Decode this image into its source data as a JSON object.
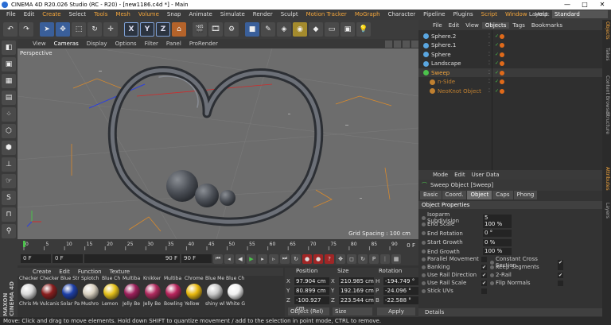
{
  "window": {
    "title": "CINEMA 4D R20.026 Studio (RC - R20) - [new1186.c4d *] - Main",
    "controls": [
      "—",
      "□",
      "✕"
    ]
  },
  "menu": {
    "items": [
      "File",
      "Edit",
      "Create",
      "Select",
      "Tools",
      "Mesh",
      "Volume",
      "Snap",
      "Animate",
      "Simulate",
      "Render",
      "Sculpt",
      "Motion Tracker",
      "MoGraph",
      "Character",
      "Pipeline",
      "Plugins",
      "Script",
      "Window",
      "Help"
    ],
    "highlight": [
      "Create",
      "Tools",
      "Mesh",
      "Volume",
      "Motion Tracker",
      "MoGraph",
      "Script",
      "Window"
    ],
    "layout_label": "Layout:",
    "layout_value": "Standard"
  },
  "toolbar": {
    "axis_labels": [
      "X",
      "Y",
      "Z"
    ]
  },
  "viewport": {
    "menu": [
      "View",
      "Cameras",
      "Display",
      "Options",
      "Filter",
      "Panel",
      "ProRender"
    ],
    "label": "Perspective",
    "grid_spacing": "Grid Spacing : 100 cm"
  },
  "timeline": {
    "ticks": [
      "0",
      "5",
      "10",
      "15",
      "20",
      "25",
      "30",
      "35",
      "40",
      "45",
      "50",
      "55",
      "60",
      "65",
      "70",
      "75",
      "80",
      "85",
      "90"
    ],
    "end_label": "0 F"
  },
  "anim": {
    "current": "0 F",
    "start": "0 F",
    "end_a": "90 F",
    "end_b": "90 F"
  },
  "materials": {
    "menu": [
      "Create",
      "Edit",
      "Function",
      "Texture"
    ],
    "items": [
      {
        "top": "Checker",
        "bottom": "Chris Me",
        "color": "#d8d8d8"
      },
      {
        "top": "Checker",
        "bottom": "Vulcanis",
        "color": "#8a1e1e"
      },
      {
        "top": "Blue Str",
        "bottom": "Solar Pa",
        "color": "#1d3fa8"
      },
      {
        "top": "Splotch",
        "bottom": "Mushro",
        "color": "#d8d0c0"
      },
      {
        "top": "Blue Ch",
        "bottom": "Lemon",
        "color": "#e5c11a"
      },
      {
        "top": "Multiba",
        "bottom": "Jelly Be",
        "color": "#9c1f5a"
      },
      {
        "top": "Knikker",
        "bottom": "Jelly Be",
        "color": "#b02a5e"
      },
      {
        "top": "Multiba",
        "bottom": "Bowling",
        "color": "#b8245c"
      },
      {
        "top": "Chrome",
        "bottom": "Yellow",
        "color": "#e8b80e"
      },
      {
        "top": "Blue Me",
        "bottom": "shiny wl",
        "color": "#c8c8c8"
      },
      {
        "top": "Blue Ch",
        "bottom": "White G",
        "color": "#f0f0f0"
      }
    ]
  },
  "coords": {
    "headers": [
      "Position",
      "Size",
      "Rotation"
    ],
    "rows": [
      {
        "a": "X",
        "pos": "97.904 cm",
        "size": "210.985 cm",
        "r": "H",
        "rot": "-194.749 °"
      },
      {
        "a": "Y",
        "pos": "80.899 cm",
        "size": "192.169 cm",
        "r": "P",
        "rot": "-24.096 °"
      },
      {
        "a": "Z",
        "pos": "-100.927 cm",
        "size": "223.544 cm",
        "r": "B",
        "rot": "-22.588 °"
      }
    ],
    "mode": "Object (Rel)",
    "size_mode": "Size",
    "apply": "Apply"
  },
  "objects": {
    "menu": [
      "File",
      "Edit",
      "View",
      "Objects",
      "Tags",
      "Bookmarks"
    ],
    "active_menu": "Objects",
    "rows": [
      {
        "name": "Sphere.2",
        "kind": "normal",
        "icon": "#5aa6e0"
      },
      {
        "name": "Sphere.1",
        "kind": "normal",
        "icon": "#5aa6e0"
      },
      {
        "name": "Sphere",
        "kind": "normal",
        "icon": "#5aa6e0"
      },
      {
        "name": "Landscape",
        "kind": "normal",
        "icon": "#5aa6e0"
      },
      {
        "name": "Sweep",
        "kind": "selected",
        "icon": "#4cc24c"
      },
      {
        "name": "n-Side",
        "kind": "sub",
        "icon": "#c08030"
      },
      {
        "name": "NeoKnot Object",
        "kind": "sub",
        "icon": "#c08030"
      }
    ]
  },
  "attributes": {
    "menu": [
      "Mode",
      "Edit",
      "User Data"
    ],
    "title": "Sweep Object [Sweep]",
    "tabs": [
      "Basic",
      "Coord.",
      "Object",
      "Caps",
      "Phong"
    ],
    "active_tab": "Object",
    "section": "Object Properties",
    "fields": [
      {
        "label": "Isoparm Subdivision",
        "value": "5"
      },
      {
        "label": "End Scale",
        "value": "100 %"
      },
      {
        "label": "End Rotation",
        "value": "0 °"
      },
      {
        "label": "Start Growth",
        "value": "0 %"
      },
      {
        "label": "End Growth",
        "value": "100 %"
      }
    ],
    "checks_left": [
      {
        "label": "Parallel Movement",
        "checked": ""
      },
      {
        "label": "Banking",
        "checked": "✔"
      },
      {
        "label": "Use Rail Direction",
        "checked": "✔"
      },
      {
        "label": "Use Rail Scale",
        "checked": "✔"
      },
      {
        "label": "Stick UVs",
        "checked": ""
      }
    ],
    "checks_right": [
      {
        "label": "Constant Cross Section",
        "checked": "✔"
      },
      {
        "label": "Keep Segments",
        "checked": ""
      },
      {
        "label": "2-Rail",
        "checked": "✔"
      },
      {
        "label": "Flip Normals",
        "checked": ""
      }
    ],
    "details": "Details"
  },
  "side_tabs": [
    "Objects",
    "Takes",
    "Content Browser",
    "Structure",
    "Attributes",
    "Layers"
  ],
  "status": "Move: Click and drag to move elements. Hold down SHIFT to quantize movement / add to the selection in point mode, CTRL to remove.",
  "maxon": "MAXON CINEMA 4D"
}
